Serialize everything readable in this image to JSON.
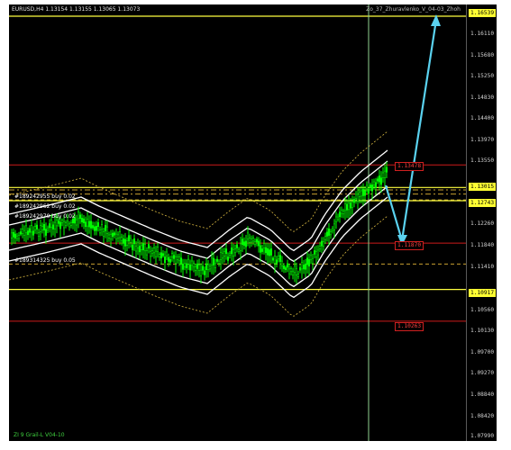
{
  "chart": {
    "symbol_line": "EURUSD,H4  1.13154 1.13155 1.13065 1.13073",
    "indicator_name": "Zo_37_Zhuravlenko_V_04-03_Zhoh",
    "footer_label": "ZI 9 Grail-L V04-10"
  },
  "orders": [
    {
      "label": "#189242955 buy 0.02",
      "price": 1.12965
    },
    {
      "label": "#189242962 buy 0.02",
      "price": 1.1288
    },
    {
      "label": "#189242970 buy 0.02",
      "price": 1.1276
    },
    {
      "label": "#189314325 buy 0.05",
      "price": 1.1144
    }
  ],
  "price_axis": {
    "ticks": [
      "1.16539",
      "1.16110",
      "1.15680",
      "1.15250",
      "1.14830",
      "1.14400",
      "1.13970",
      "1.13550",
      "1.13015",
      "1.12743",
      "1.12260",
      "1.11840",
      "1.11410",
      "1.10917",
      "1.10560",
      "1.10130",
      "1.09700",
      "1.09270",
      "1.08840",
      "1.08420",
      "1.07990"
    ],
    "yellow_badges": [
      "1.16539",
      "1.13015",
      "1.12743",
      "1.10917"
    ]
  },
  "levels": {
    "red_lines": [
      {
        "label": "1.13478",
        "price": 1.13478
      },
      {
        "label": "1.11870",
        "price": 1.1187
      },
      {
        "label": "1.10263",
        "price": 1.10263
      }
    ],
    "yellow_lines": [
      1.16539,
      1.13015,
      1.12743,
      1.10917
    ]
  },
  "colors": {
    "background": "#000000",
    "candle": "#00ff00",
    "band": "#ffffff",
    "dotted_band": "#d8b840",
    "red_level": "#cc1a1a",
    "yellow_level": "#ffff40",
    "forecast_arrow": "#5ad2f0",
    "cursor_line": "#8fd28f"
  }
}
